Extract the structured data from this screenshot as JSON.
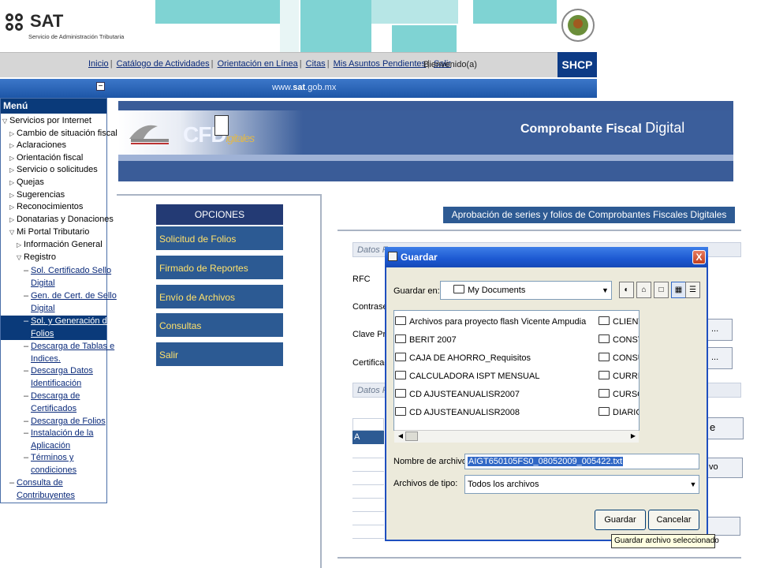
{
  "header": {
    "logo_text": "SAT",
    "logo_subtitle": "Servicio de Administración Tributaria",
    "nav_links": [
      "Inicio",
      "Catálogo de Actividades",
      "Orientación en Línea",
      "Citas",
      "Mis Asuntos Pendientes",
      "Salir"
    ],
    "welcome": "Bienvenido(a)",
    "shcp": "SHCP",
    "url_prefix": "www.",
    "url_domain": "sat",
    "url_suffix": ".gob.mx",
    "collapse": "−"
  },
  "menu": {
    "title": "Menú",
    "items": [
      {
        "label": "Servicios por Internet"
      },
      {
        "label": "Cambio de situación fiscal"
      },
      {
        "label": "Aclaraciones"
      },
      {
        "label": "Orientación fiscal"
      },
      {
        "label": "Servicio o solicitudes"
      },
      {
        "label": "Quejas"
      },
      {
        "label": "Sugerencias"
      },
      {
        "label": "Reconocimientos"
      },
      {
        "label": "Donatarias y Donaciones"
      },
      {
        "label": "Mi Portal Tributario"
      },
      {
        "label": "Información General"
      },
      {
        "label": "Registro"
      }
    ],
    "subitems": [
      {
        "line1": "Sol. Certificado Sello",
        "line2": "Digital"
      },
      {
        "line1": "Gen. de Cert. de Sello",
        "line2": "Digital"
      },
      {
        "line1": "Sol. y Generación de",
        "line2": "Folios"
      },
      {
        "line1": "Descarga de Tablas e",
        "line2": "Indices."
      },
      {
        "line1": "Descarga Datos",
        "line2": "Identificación"
      },
      {
        "line1": "Descarga de",
        "line2": "Certificados"
      },
      {
        "line1": "Descarga de Folios",
        "line2": ""
      },
      {
        "line1": "Instalación de la",
        "line2": "Aplicación"
      },
      {
        "line1": "Términos y",
        "line2": "condiciones"
      }
    ],
    "last": {
      "line1": "Consulta de",
      "line2": "Contribuyentes"
    }
  },
  "banner": {
    "logo": "CFD",
    "logo_script": "igitales",
    "title_bold": "Comprobante Fiscal",
    "title_light": "Digital"
  },
  "options": {
    "heading": "OPCIONES",
    "items": [
      "Solicitud de Folios",
      "Firmado de Reportes",
      "Envío de Archivos",
      "Consultas",
      "Salir"
    ]
  },
  "page": {
    "title": "Aprobación de series y folios de Comprobantes Fiscales Digitales",
    "fieldset1": "Datos F",
    "fieldset2": "Datos F",
    "labels": [
      "RFC",
      "Contrase",
      "Clave Priv",
      "Certificad"
    ],
    "browse1": "...",
    "browse2": "...",
    "btn_e": "e",
    "btn_vo": "vo",
    "table_cell": "A"
  },
  "dialog": {
    "title": "Guardar",
    "close": "X",
    "lookin_label": "Guardar en:",
    "lookin_value": "My Documents",
    "files_left": [
      "Archivos para proyecto flash Vicente Ampudia",
      "BERIT 2007",
      "CAJA DE AHORRO_Requisitos",
      "CALCULADORA ISPT MENSUAL",
      "CD AJUSTEANUALISR2007",
      "CD AJUSTEANUALISR2008"
    ],
    "files_right": [
      "CLIENTE",
      "CONSTA",
      "CONSUL",
      "CURRICU",
      "CURSOS",
      "DIARIOS"
    ],
    "filename_label": "Nombre de archivo:",
    "filename_value": "AIGT650105FS0_08052009_005422.txt",
    "filetype_label": "Archivos de tipo:",
    "filetype_value": "Todos los archivos",
    "save_button": "Guardar",
    "cancel_button": "Cancelar",
    "tooltip": "Guardar archivo seleccionado"
  },
  "colors": {
    "dark_blue": "#0a3a7a",
    "option_blue": "#2c5a93",
    "option_text": "#ffe16b",
    "teal": "#7fd3d3",
    "dialog_title": "#1c58d1"
  }
}
